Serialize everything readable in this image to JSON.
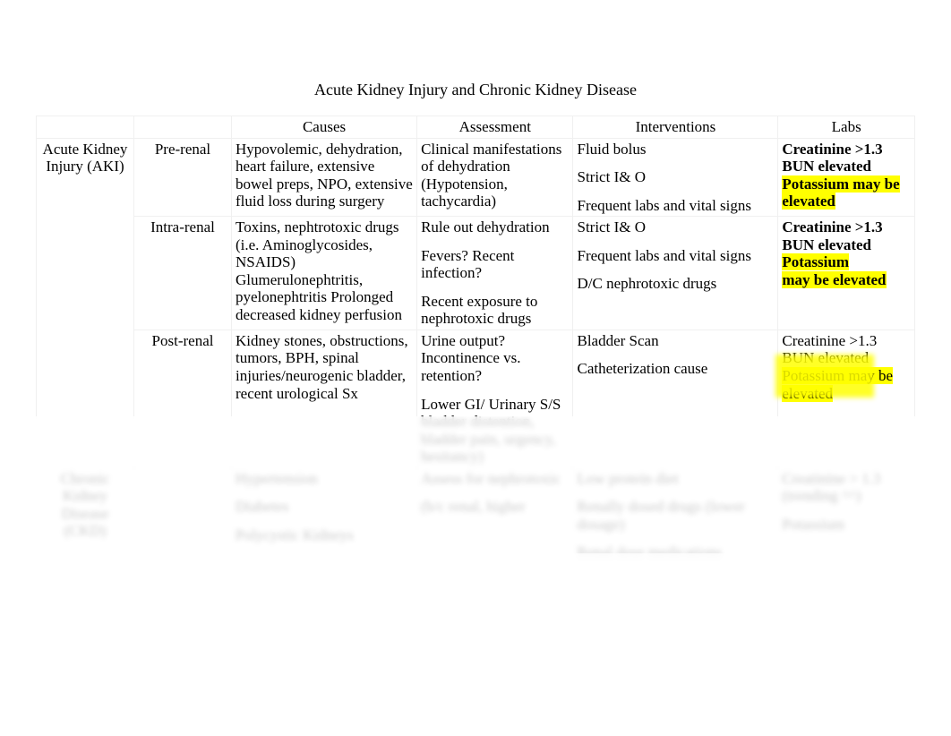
{
  "title": "Acute Kidney Injury and Chronic Kidney Disease",
  "headers": {
    "blank1": "",
    "blank2": "",
    "causes": "Causes",
    "assessment": "Assessment",
    "interventions": "Interventions",
    "labs": "Labs"
  },
  "rows": {
    "aki": {
      "label": "Acute Kidney Injury (AKI)",
      "prerenal": {
        "label": "Pre-renal",
        "causes": "Hypovolemic, dehydration, heart failure, extensive bowel preps, NPO, extensive fluid loss during surgery",
        "assessment": "Clinical manifestations of dehydration (Hypotension, tachycardia)",
        "interventions_1": "Fluid bolus",
        "interventions_2": "Strict I& O",
        "interventions_3": "Frequent labs and vital signs",
        "labs_creat": "Creatinine >1.3",
        "labs_bun": "BUN elevated",
        "labs_k": "Potassium may be elevated"
      },
      "intrarenal": {
        "label": "Intra-renal",
        "causes": "Toxins, nephtrotoxic drugs (i.e. Aminoglycosides, NSAIDS) Glumerulonephtritis, pyelonephtritis Prolonged decreased kidney perfusion",
        "assessment_1": "Rule out dehydration",
        "assessment_2": "Fevers? Recent infection?",
        "assessment_3": "Recent exposure to nephrotoxic drugs",
        "interventions_1": "Strict I& O",
        "interventions_2": "Frequent labs and vital signs",
        "interventions_3": "D/C nephrotoxic drugs",
        "labs_creat": "Creatinine >1.3",
        "labs_bun": "BUN elevated",
        "labs_k": "Potassium",
        "labs_k2": "may be elevated"
      },
      "postrenal": {
        "label": "Post-renal",
        "causes": "Kidney stones, obstructions, tumors, BPH, spinal injuries/neurogenic bladder, recent urological Sx",
        "assessment_1": "Urine output? Incontinence vs. retention?",
        "assessment_2": "Lower GI/ Urinary S/S bladder distention, bladder pain, urgency, hesitancy)",
        "interventions_1": "Bladder Scan",
        "interventions_2": "Catheterization cause",
        "labs_1": "Creatinine >1.3",
        "labs_2": "BUN elevated",
        "labs_3": "Potassium may be elevated"
      }
    },
    "ckd": {
      "label": "Chronic Kidney Disease (CKD)",
      "causes_1": "Hypertension",
      "causes_2": "Diabetes",
      "causes_3": "Polycystic Kidneys",
      "assessment_1": "Assess for nephrotoxic",
      "assessment_2": "(b/c renal, higher",
      "interventions_1": "Low protein diet",
      "interventions_2": "Renally dosed drugs (lower dosage)",
      "interventions_3": "Renal dose medications",
      "labs_1": "Creatinine > 1.3 (trending ^^)",
      "labs_2": "Potassium"
    }
  }
}
